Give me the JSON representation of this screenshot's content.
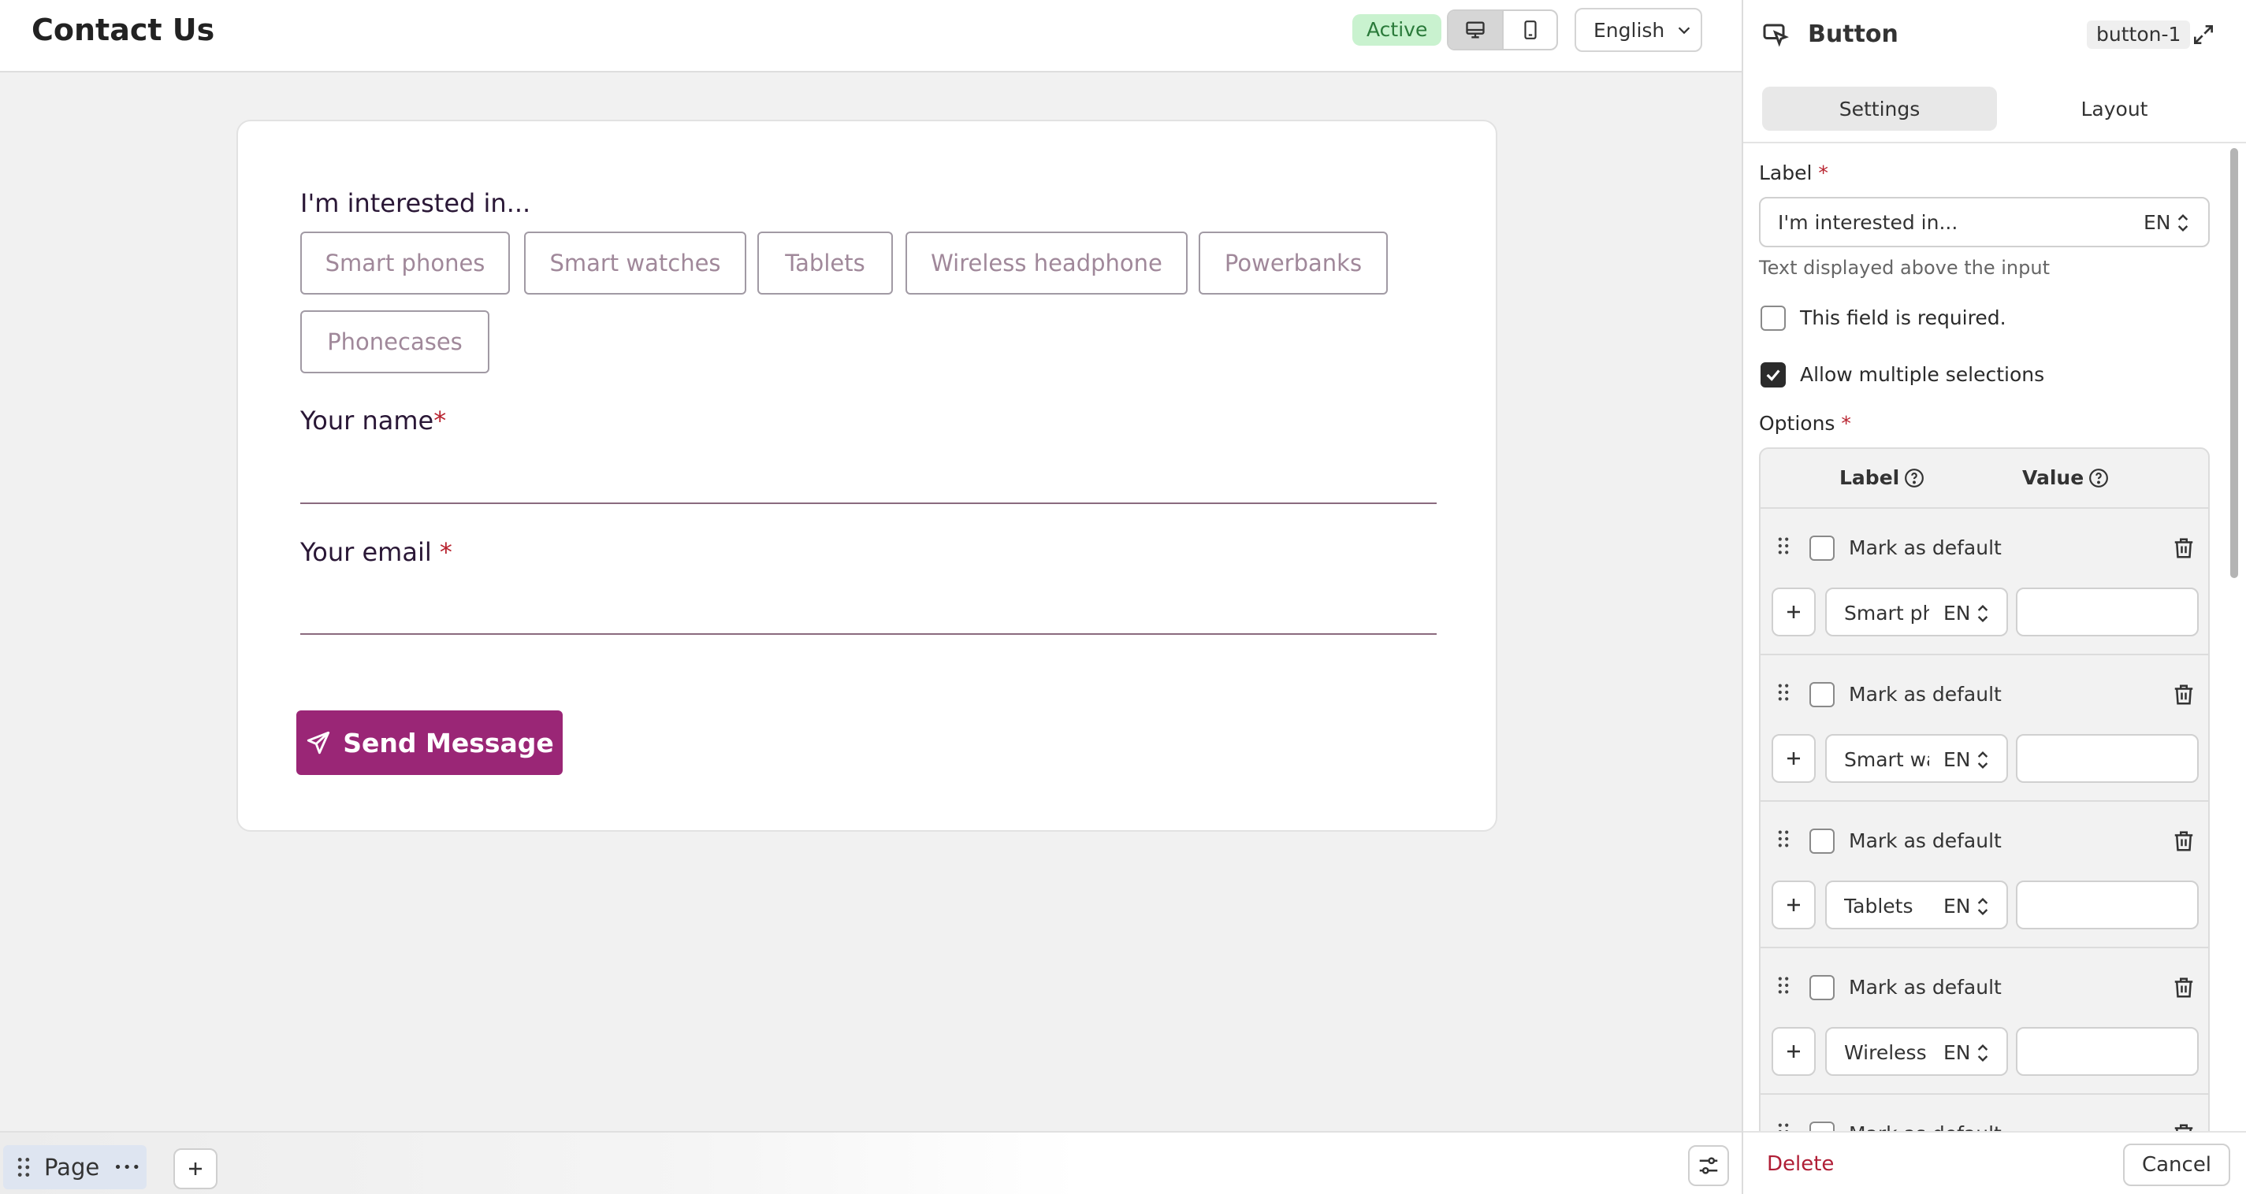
{
  "header": {
    "title": "Contact Us",
    "status": "Active",
    "language": "English",
    "devices": [
      "desktop-icon",
      "mobile-icon"
    ]
  },
  "form": {
    "interest_label": "I'm interested in...",
    "choices": [
      "Smart phones",
      "Smart watches",
      "Tablets",
      "Wireless headphone",
      "Powerbanks",
      "Phonecases"
    ],
    "name_label": "Your name",
    "email_label": "Your email ",
    "required_mark": "*",
    "send_label": "Send Message"
  },
  "bottom_bar": {
    "page_label": "Page",
    "more": "•••"
  },
  "panel": {
    "title": "Button",
    "element_id": "button-1",
    "tabs": [
      "Settings",
      "Layout"
    ],
    "active_tab": "Settings",
    "label_title": "Label",
    "required_mark": "*",
    "label_value": "I'm interested in...",
    "lang_code": "EN",
    "label_hint": "Text displayed above the input",
    "required_checkbox_label": "This field is required.",
    "required_checked": false,
    "multi_checkbox_label": "Allow multiple selections",
    "multi_checked": true,
    "options_title": "Options",
    "options_headers": {
      "label": "Label",
      "value": "Value"
    },
    "options": [
      {
        "default_label": "Mark as default",
        "label": "Smart ph",
        "lang": "EN",
        "value": ""
      },
      {
        "default_label": "Mark as default",
        "label": "Smart wa",
        "lang": "EN",
        "value": ""
      },
      {
        "default_label": "Mark as default",
        "label": "Tablets",
        "lang": "EN",
        "value": ""
      },
      {
        "default_label": "Mark as default",
        "label": "Wireless",
        "lang": "EN",
        "value": ""
      },
      {
        "default_label": "Mark as default",
        "label": "",
        "lang": "",
        "value": ""
      }
    ],
    "delete_label": "Delete",
    "cancel_label": "Cancel"
  },
  "colors": {
    "brand": "#9a2676",
    "active_badge_bg": "#c9f2cf",
    "active_badge_text": "#2a7a3a",
    "required": "#b8232f",
    "delete": "#b01e36"
  }
}
